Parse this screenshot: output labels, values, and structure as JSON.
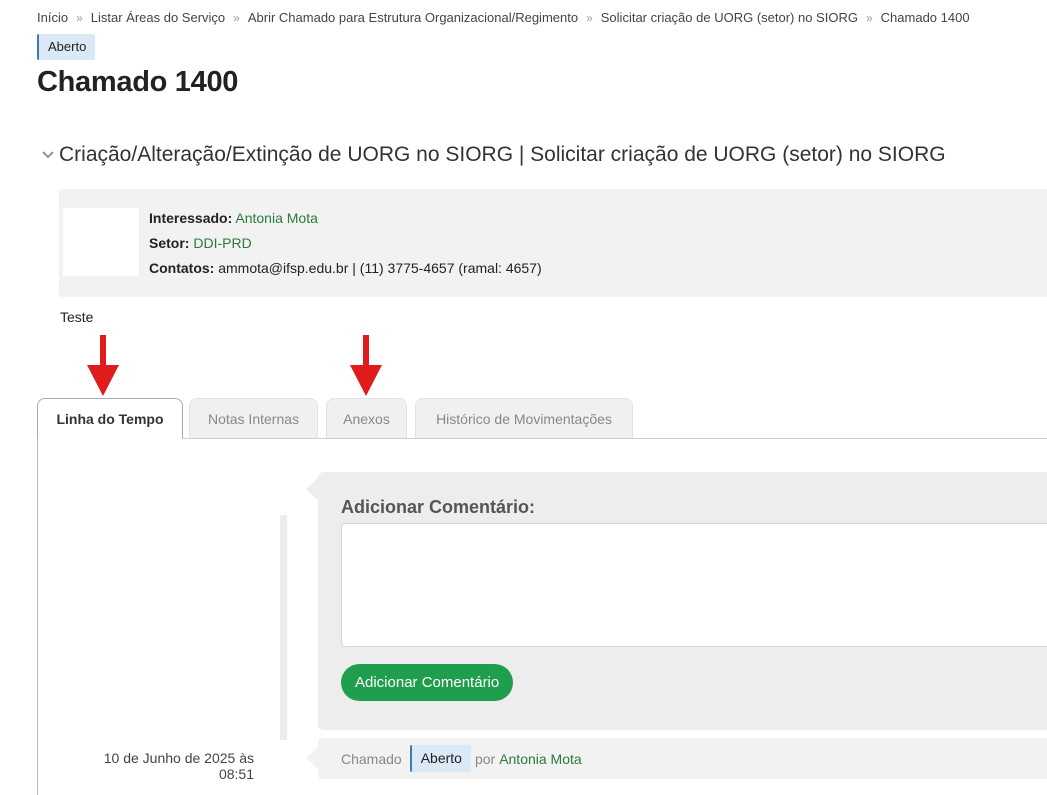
{
  "breadcrumb": {
    "items": [
      "Início",
      "Listar Áreas do Serviço",
      "Abrir Chamado para Estrutura Organizacional/Regimento",
      "Solicitar criação de UORG (setor) no SIORG",
      "Chamado 1400"
    ],
    "separator": "»"
  },
  "status": {
    "label": "Aberto",
    "color": "#dbe9f6"
  },
  "page_title": "Chamado 1400",
  "section": {
    "title": "Criação/Alteração/Extinção de UORG no SIORG | Solicitar criação de UORG (setor) no SIORG",
    "icon": "chevron-down-icon"
  },
  "requester": {
    "interessado_label": "Interessado:",
    "interessado_value": "Antonia Mota",
    "setor_label": "Setor:",
    "setor_value": "DDI-PRD",
    "contatos_label": "Contatos:",
    "contatos_value": "ammota@ifsp.edu.br | (11) 3775-4657 (ramal: 4657)"
  },
  "description": "Teste",
  "tabs": [
    {
      "label": "Linha do Tempo",
      "active": true
    },
    {
      "label": "Notas Internas",
      "active": false
    },
    {
      "label": "Anexos",
      "active": false
    },
    {
      "label": "Histórico de Movimentações",
      "active": false
    }
  ],
  "comment": {
    "title": "Adicionar Comentário:",
    "value": "",
    "button_label": "Adicionar Comentário",
    "button_color": "#1f9e4d"
  },
  "timeline_event": {
    "date": "10 de Junho de 2025 às",
    "time": "08:51",
    "prefix": "Chamado",
    "status": "Aberto",
    "by": "por",
    "user": "Antonia Mota"
  },
  "colors": {
    "accent_green": "#2b7a3b",
    "arrow_red": "#e01b1b"
  }
}
